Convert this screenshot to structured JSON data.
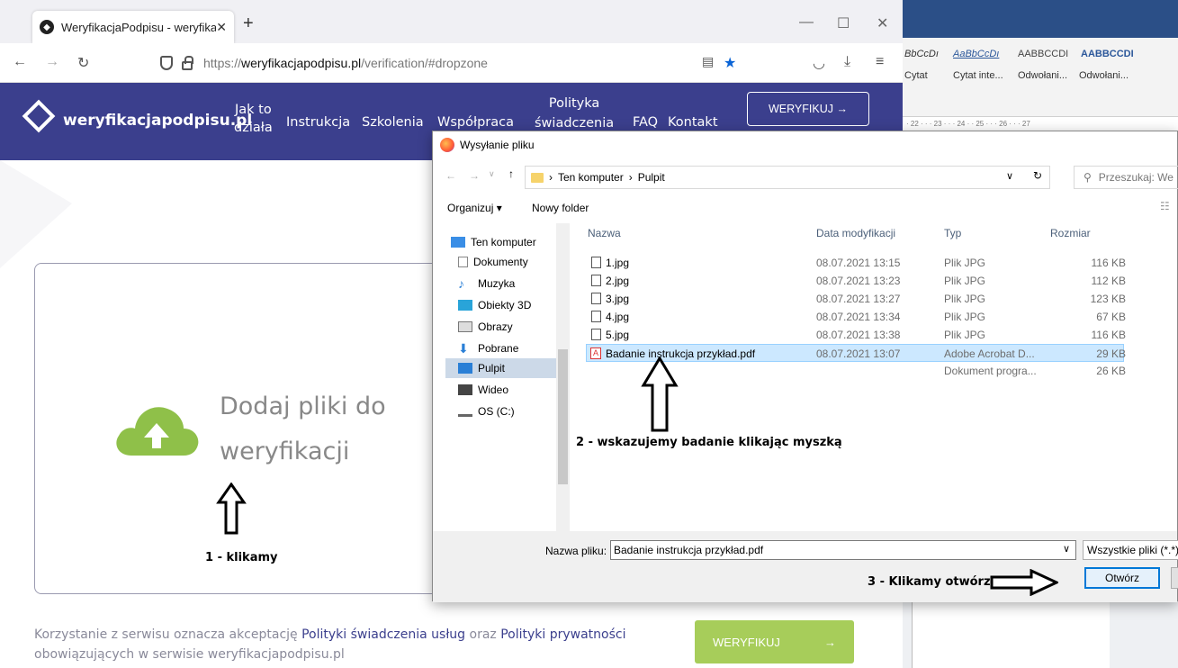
{
  "browser": {
    "tab_title": "WeryfikacjaPodpisu - weryfikac",
    "url_prefix": "https://",
    "url_domain": "weryfikacjapodpisu.pl",
    "url_path": "/verification/#dropzone"
  },
  "site": {
    "logo": "weryfikacjapodpisu.pl",
    "nav": {
      "jak_to_1": "Jak to",
      "jak_to_2": "działa",
      "instrukcja": "Instrukcja",
      "szkolenia": "Szkolenia",
      "wspolpraca": "Współpraca",
      "polityka_1": "Polityka",
      "polityka_2": "świadczenia",
      "faq": "FAQ",
      "kontakt": "Kontakt"
    },
    "header_button": "WERYFIKUJ →",
    "dropzone_line1": "Dodaj pliki do",
    "dropzone_line2": "weryfikacji",
    "footer": {
      "t1": "Korzystanie z serwisu oznacza akceptację ",
      "l1": "Polityki świadczenia usług",
      "t2": " oraz ",
      "l2": "Polityki prywatności",
      "t3": " obowiązujących w serwisie weryfikacjapodpisu.pl"
    },
    "verify_button": "WERYFIKUJ",
    "verify_arrow": "→"
  },
  "annotations": {
    "step1": "1 - klikamy",
    "step2": "2 - wskazujemy badanie klikając myszką",
    "step3": "3 - Klikamy otwórz"
  },
  "word": {
    "styles": [
      "BbCcDı",
      "AaBbCcDı",
      "AABBCCDI",
      "AABBCCDI"
    ],
    "captions": [
      "Cytat",
      "Cytat inte...",
      "Odwołani...",
      "Odwołani..."
    ],
    "ruler": "· 22 · · · 23 · · · 24 · · 25 · · · 26 · · · 27"
  },
  "dialog": {
    "title": "Wysyłanie pliku",
    "path_1": "Ten komputer",
    "path_2": "Pulpit",
    "search_placeholder": "Przeszukaj: We",
    "organize": "Organizuj ▾",
    "new_folder": "Nowy folder",
    "nav_items": [
      "Ten komputer",
      "Dokumenty",
      "Muzyka",
      "Obiekty 3D",
      "Obrazy",
      "Pobrane",
      "Pulpit",
      "Wideo",
      "OS (C:)"
    ],
    "columns": {
      "name": "Nazwa",
      "date": "Data modyfikacji",
      "type": "Typ",
      "size": "Rozmiar"
    },
    "files": [
      {
        "name": "1.jpg",
        "date": "08.07.2021 13:15",
        "type": "Plik JPG",
        "size": "116 KB"
      },
      {
        "name": "2.jpg",
        "date": "08.07.2021 13:23",
        "type": "Plik JPG",
        "size": "112 KB"
      },
      {
        "name": "3.jpg",
        "date": "08.07.2021 13:27",
        "type": "Plik JPG",
        "size": "123 KB"
      },
      {
        "name": "4.jpg",
        "date": "08.07.2021 13:34",
        "type": "Plik JPG",
        "size": "67 KB"
      },
      {
        "name": "5.jpg",
        "date": "08.07.2021 13:38",
        "type": "Plik JPG",
        "size": "116 KB"
      },
      {
        "name": "Badanie instrukcja przykład.pdf",
        "date": "08.07.2021 13:07",
        "type": "Adobe Acrobat D...",
        "size": "29 KB"
      },
      {
        "name": "",
        "date": "",
        "type": "Dokument progra...",
        "size": "26 KB"
      }
    ],
    "filename_label": "Nazwa pliku:",
    "filename_value": "Badanie instrukcja przykład.pdf",
    "filetype": "Wszystkie pliki (*.*)",
    "open_button": "Otwórz"
  },
  "colors": {
    "header_bg": "#3b3f8d",
    "accent_green": "#a7cd5a",
    "selection": "#cce8ff"
  }
}
